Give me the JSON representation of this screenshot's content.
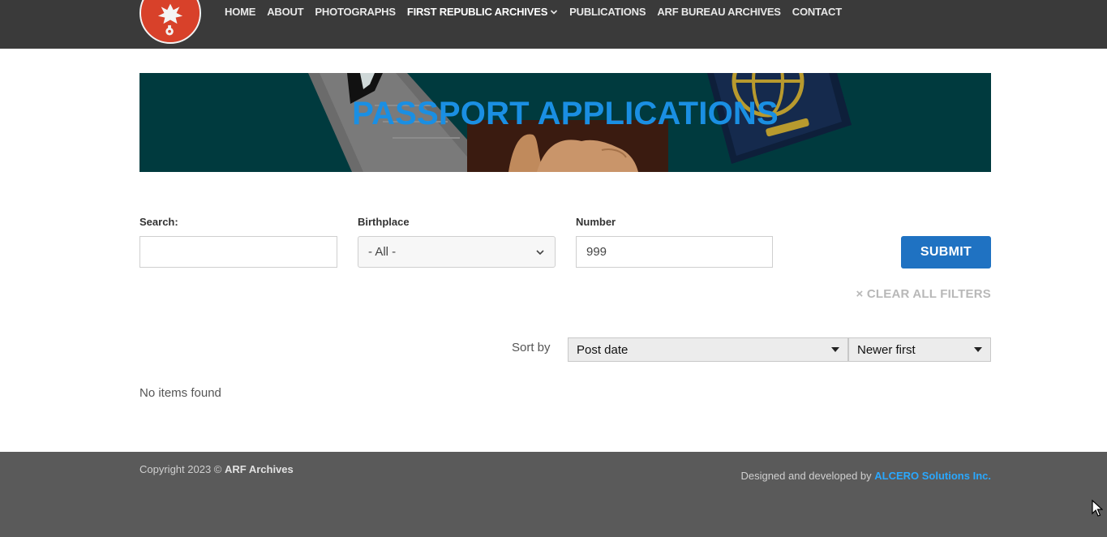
{
  "nav": {
    "items": [
      {
        "label": "HOME"
      },
      {
        "label": "ABOUT"
      },
      {
        "label": "PHOTOGRAPHS"
      },
      {
        "label": "FIRST REPUBLIC ARCHIVES"
      },
      {
        "label": "PUBLICATIONS"
      },
      {
        "label": "ARF BUREAU ARCHIVES"
      },
      {
        "label": "CONTACT"
      }
    ]
  },
  "banner": {
    "title": "PASSPORT APPLICATIONS"
  },
  "filters": {
    "search": {
      "label": "Search:",
      "value": ""
    },
    "birthplace": {
      "label": "Birthplace",
      "value": "- All -"
    },
    "number": {
      "label": "Number",
      "value": "999"
    },
    "submit_label": "SUBMIT",
    "clear_label": "× CLEAR ALL FILTERS"
  },
  "sort": {
    "label": "Sort by",
    "field": "Post date",
    "order": "Newer first"
  },
  "results": {
    "empty_text": "No items found"
  },
  "footer": {
    "copyright_prefix": "Copyright 2023 © ",
    "copyright_owner": "ARF Archives",
    "credits_prefix": "Designed and developed by ",
    "credits_link": "ALCERO Solutions Inc."
  },
  "colors": {
    "header_bg": "#3a3a3a",
    "banner_bg": "#003a3e",
    "title_blue": "#1a8fe3",
    "button_blue": "#1f72c2",
    "footer_bg": "#5a5a5a",
    "link_blue": "#2aa8ff",
    "logo_red": "#d8412a"
  }
}
